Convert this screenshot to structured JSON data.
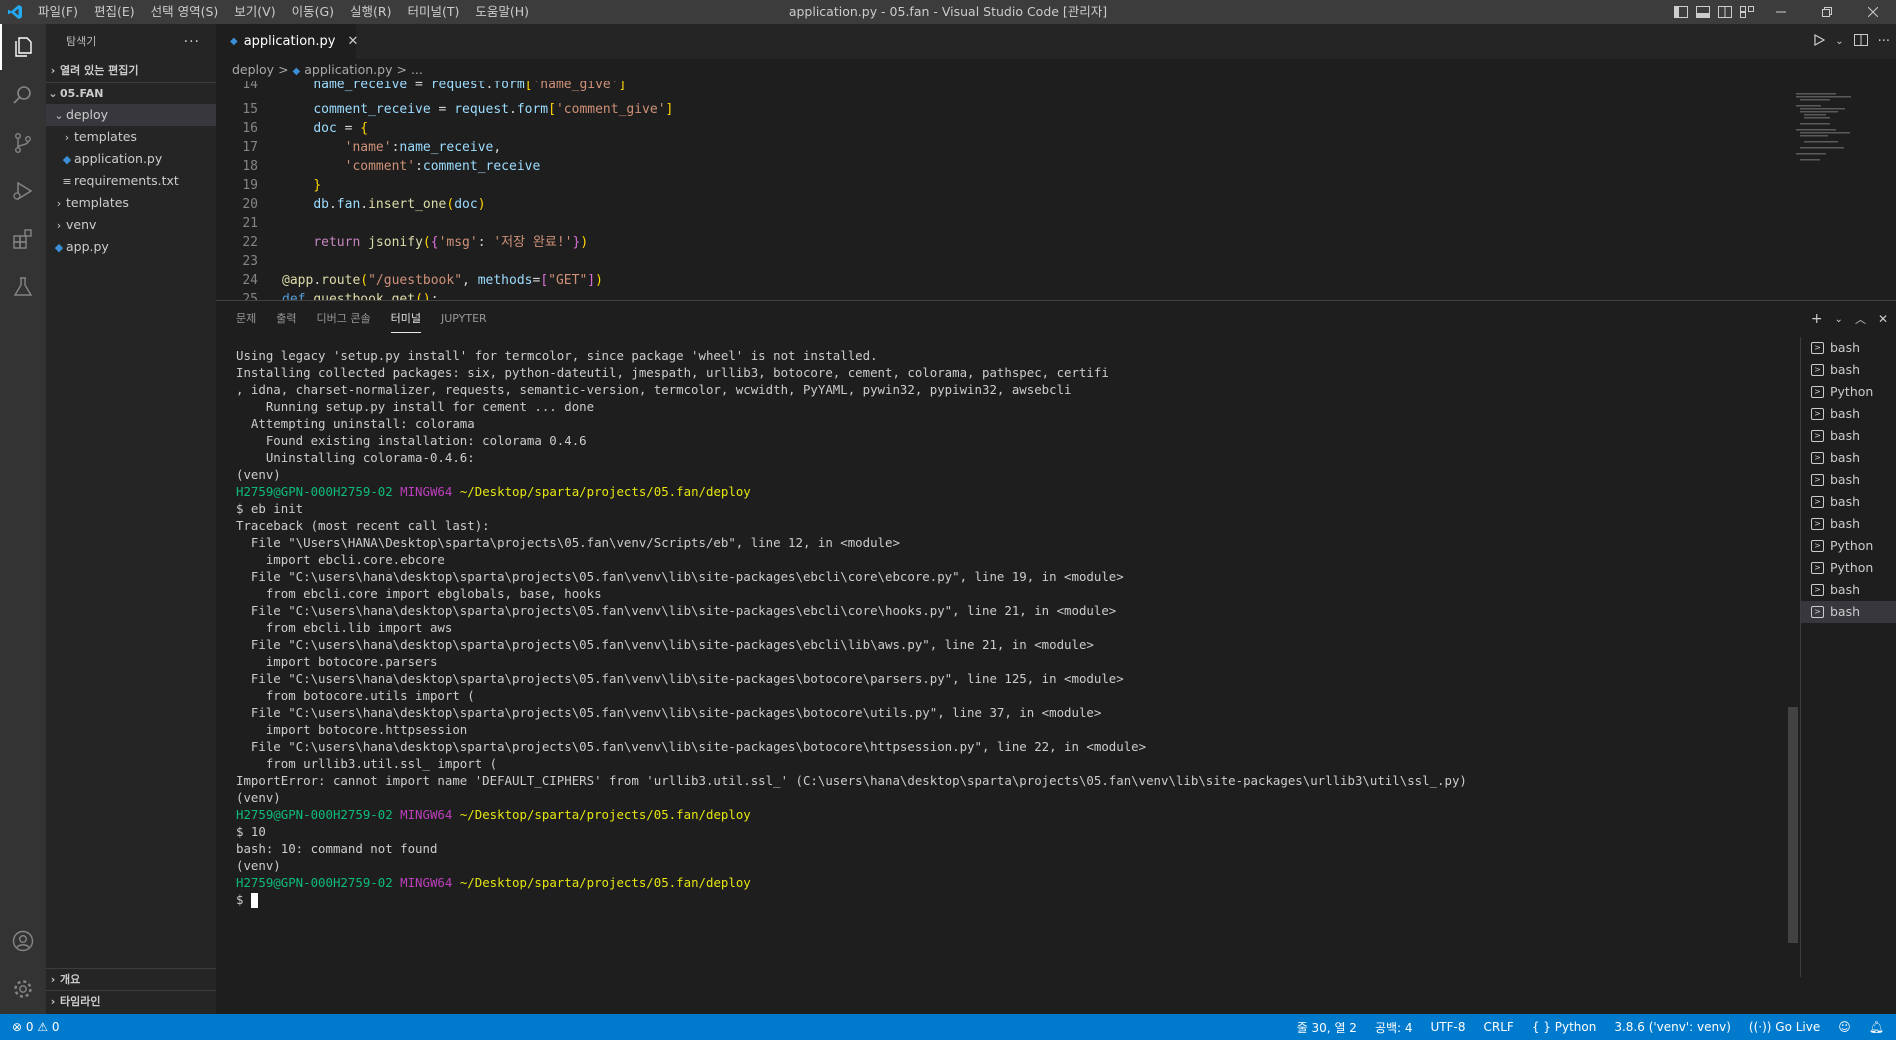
{
  "window": {
    "title": "application.py - 05.fan - Visual Studio Code [관리자]",
    "menus": [
      "파일(F)",
      "편집(E)",
      "선택 영역(S)",
      "보기(V)",
      "이동(G)",
      "실행(R)",
      "터미널(T)",
      "도움말(H)"
    ]
  },
  "sidebar": {
    "header": "탐색기",
    "more": "···",
    "open_editors": "열려 있는 편집기",
    "root": "05.FAN",
    "items": [
      {
        "label": "deploy"
      },
      {
        "label": "templates"
      },
      {
        "label": "application.py"
      },
      {
        "label": "requirements.txt"
      },
      {
        "label": "templates"
      },
      {
        "label": "venv"
      },
      {
        "label": "app.py"
      }
    ],
    "outline": "개요",
    "timeline": "타임라인"
  },
  "editor": {
    "tab_label": "application.py",
    "tab_close": "✕",
    "breadcrumb": {
      "folder": "deploy",
      "sep": ">",
      "file": "application.py",
      "tail": "..."
    },
    "line_numbers": [
      "14",
      "15",
      "16",
      "17",
      "18",
      "19",
      "20",
      "21",
      "22",
      "23",
      "24",
      "25"
    ]
  },
  "panel": {
    "tabs": [
      "문제",
      "출력",
      "디버그 콘솔",
      "터미널",
      "JUPYTER"
    ],
    "active_tab": "터미널",
    "plus": "+",
    "terminals": [
      "bash",
      "bash",
      "Python",
      "bash",
      "bash",
      "bash",
      "bash",
      "bash",
      "bash",
      "Python",
      "Python",
      "bash",
      "bash"
    ],
    "terminal_lines": [
      "Using legacy 'setup.py install' for termcolor, since package 'wheel' is not installed.",
      "Installing collected packages: six, python-dateutil, jmespath, urllib3, botocore, cement, colorama, pathspec, certifi",
      ", idna, charset-normalizer, requests, semantic-version, termcolor, wcwidth, PyYAML, pywin32, pypiwin32, awsebcli",
      "    Running setup.py install for cement ... done",
      "  Attempting uninstall: colorama",
      "    Found existing installation: colorama 0.4.6",
      "    Uninstalling colorama-0.4.6:",
      "(venv)"
    ],
    "prompt_user": "H2759@GPN-000H2759-02",
    "prompt_env": "MINGW64",
    "prompt_path": "~/Desktop/sparta/projects/05.fan/deploy",
    "cmd1": "$ eb init",
    "traceback": [
      "Traceback (most recent call last):",
      "  File \"\\Users\\HANA\\Desktop\\sparta\\projects\\05.fan\\venv/Scripts/eb\", line 12, in <module>",
      "    import ebcli.core.ebcore",
      "  File \"C:\\users\\hana\\desktop\\sparta\\projects\\05.fan\\venv\\lib\\site-packages\\ebcli\\core\\ebcore.py\", line 19, in <module>",
      "    from ebcli.core import ebglobals, base, hooks",
      "  File \"C:\\users\\hana\\desktop\\sparta\\projects\\05.fan\\venv\\lib\\site-packages\\ebcli\\core\\hooks.py\", line 21, in <module>",
      "    from ebcli.lib import aws",
      "  File \"C:\\users\\hana\\desktop\\sparta\\projects\\05.fan\\venv\\lib\\site-packages\\ebcli\\lib\\aws.py\", line 21, in <module>",
      "    import botocore.parsers",
      "  File \"C:\\users\\hana\\desktop\\sparta\\projects\\05.fan\\venv\\lib\\site-packages\\botocore\\parsers.py\", line 125, in <module>",
      "    from botocore.utils import (",
      "  File \"C:\\users\\hana\\desktop\\sparta\\projects\\05.fan\\venv\\lib\\site-packages\\botocore\\utils.py\", line 37, in <module>",
      "    import botocore.httpsession",
      "  File \"C:\\users\\hana\\desktop\\sparta\\projects\\05.fan\\venv\\lib\\site-packages\\botocore\\httpsession.py\", line 22, in <module>",
      "    from urllib3.util.ssl_ import (",
      "ImportError: cannot import name 'DEFAULT_CIPHERS' from 'urllib3.util.ssl_' (C:\\users\\hana\\desktop\\sparta\\projects\\05.fan\\venv\\lib\\site-packages\\urllib3\\util\\ssl_.py)",
      "(venv)"
    ],
    "cmd2": "$ 10",
    "cmd2_out": "bash: 10: command not found",
    "venv": "(venv)",
    "last_prompt": "$ "
  },
  "statusbar": {
    "problems": "⊗ 0 ⚠ 0",
    "position": "줄 30, 열 2",
    "spaces": "공백: 4",
    "encoding": "UTF-8",
    "eol": "CRLF",
    "language": "Python",
    "interpreter": "3.8.6 ('venv': venv)",
    "golive": "Go Live"
  }
}
